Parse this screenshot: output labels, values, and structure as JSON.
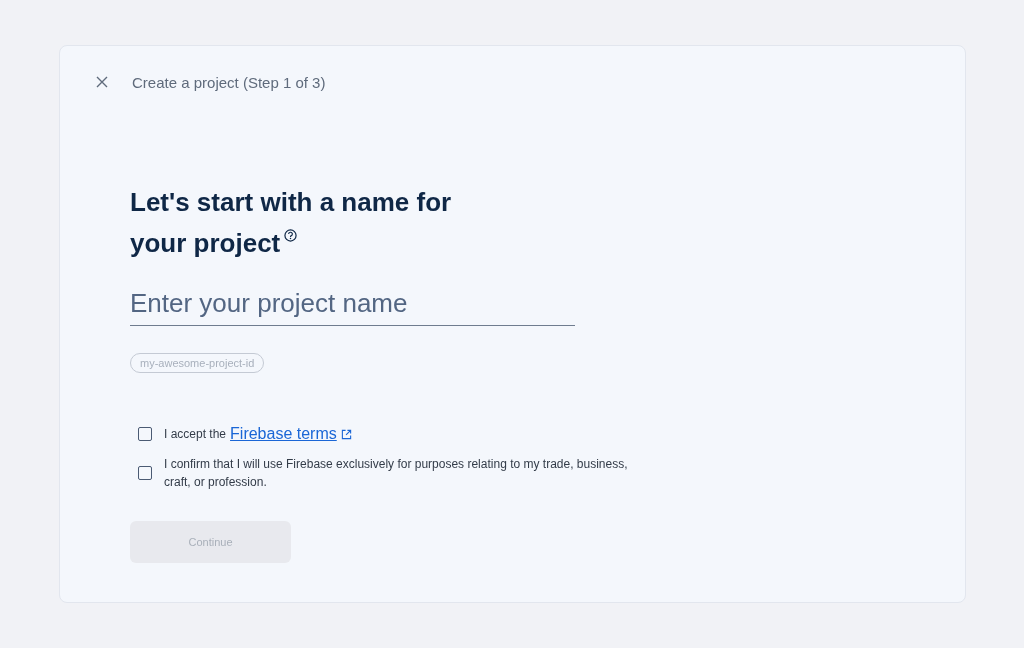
{
  "header": {
    "title": "Create a project (Step 1 of 3)"
  },
  "heading": {
    "line_1": "Let's start with a name for",
    "line_2": "your project"
  },
  "name_field": {
    "placeholder": "Enter your project name"
  },
  "project_id_chip": "my-awesome-project-id",
  "agreements": [
    {
      "text": "I accept the",
      "link": "Firebase terms",
      "checked": false
    },
    {
      "text": "I confirm that I will use Firebase exclusively for purposes relating to my trade, business, craft, or profession.",
      "checked": false
    }
  ],
  "continue_button": {
    "label": "Continue",
    "disabled": true
  }
}
